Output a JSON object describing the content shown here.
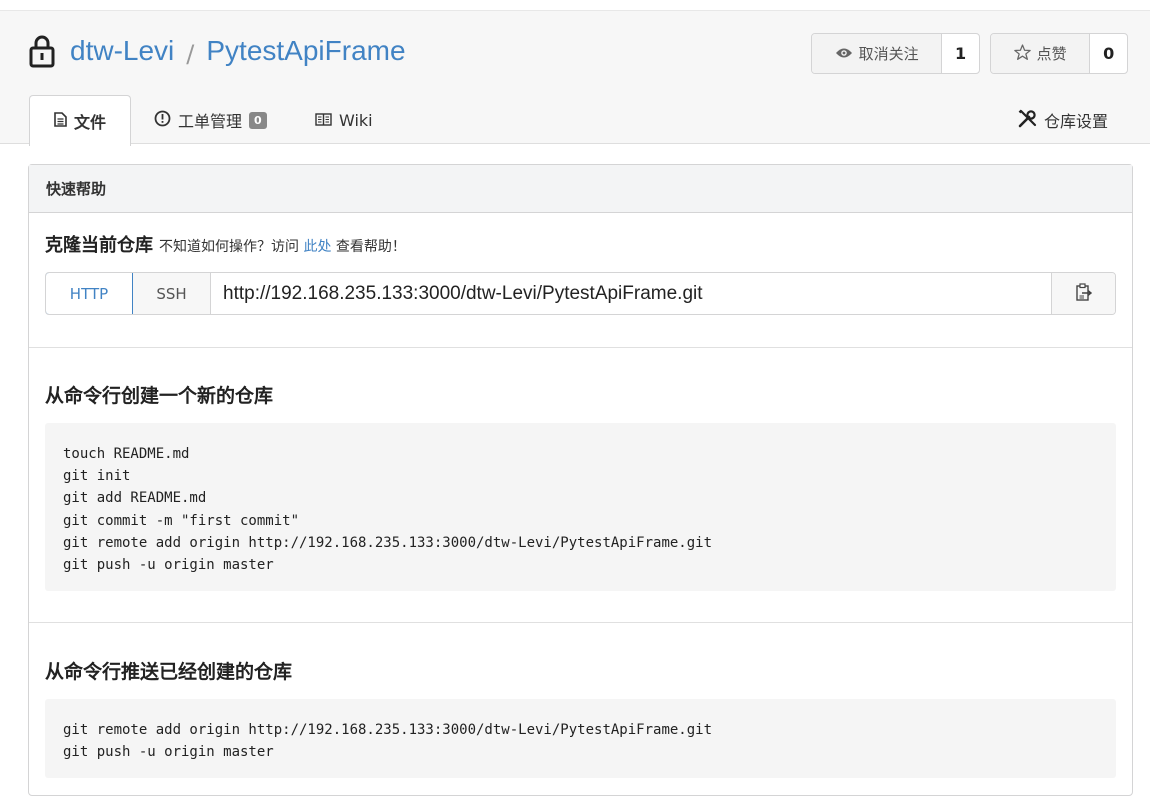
{
  "repo": {
    "owner": "dtw-Levi",
    "separator": "/",
    "name": "PytestApiFrame"
  },
  "actions": {
    "watch": {
      "label": "取消关注",
      "count": "1",
      "icon": "eye-icon"
    },
    "star": {
      "label": "点赞",
      "count": "0",
      "icon": "star-icon"
    }
  },
  "tabs": {
    "files": {
      "label": "文件",
      "icon": "file-icon"
    },
    "issues": {
      "label": "工单管理",
      "badge": "0",
      "icon": "issue-icon"
    },
    "wiki": {
      "label": "Wiki",
      "icon": "book-icon"
    },
    "settings": {
      "label": "仓库设置",
      "icon": "tools-icon"
    }
  },
  "quick_help": {
    "header": "快速帮助",
    "clone_title": "克隆当前仓库",
    "help_prefix": "不知道如何操作？访问",
    "help_link": "此处",
    "help_suffix": "查看帮助！",
    "protocols": [
      "HTTP",
      "SSH"
    ],
    "selected_protocol": "HTTP",
    "clone_url": "http://192.168.235.133:3000/dtw-Levi/PytestApiFrame.git"
  },
  "new_repo": {
    "title": "从命令行创建一个新的仓库",
    "code": "touch README.md\ngit init\ngit add README.md\ngit commit -m \"first commit\"\ngit remote add origin http://192.168.235.133:3000/dtw-Levi/PytestApiFrame.git\ngit push -u origin master"
  },
  "push_existing": {
    "title": "从命令行推送已经创建的仓库",
    "code": "git remote add origin http://192.168.235.133:3000/dtw-Levi/PytestApiFrame.git\ngit push -u origin master"
  },
  "colors": {
    "link": "#4183c4",
    "header_bg": "#f7f7f7",
    "code_bg": "#f5f5f5"
  }
}
